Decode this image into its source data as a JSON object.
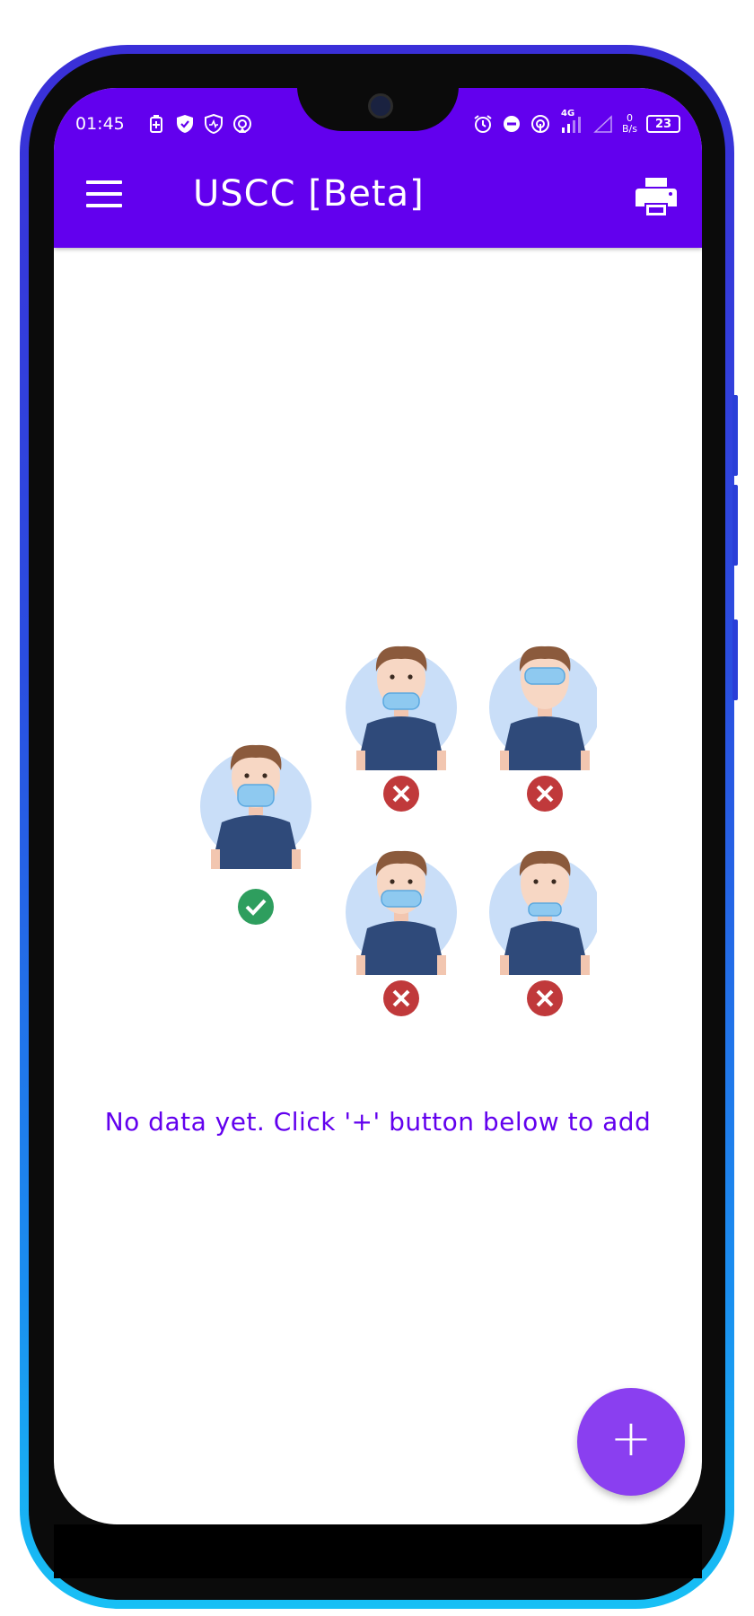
{
  "status_bar": {
    "time": "01:45",
    "network": "4G",
    "speed_value": "0",
    "speed_unit": "B/s",
    "battery": "23"
  },
  "app_bar": {
    "title": "USCC [Beta]",
    "menu_icon": "hamburger-menu-icon",
    "print_icon": "printer-icon"
  },
  "empty_state": {
    "message": "No data yet. Click '+' button below to add"
  },
  "fab": {
    "label": "+"
  },
  "colors": {
    "primary": "#6200ee",
    "fab": "#8a3ff0",
    "correct": "#2e9e5e",
    "incorrect": "#c0393b"
  }
}
